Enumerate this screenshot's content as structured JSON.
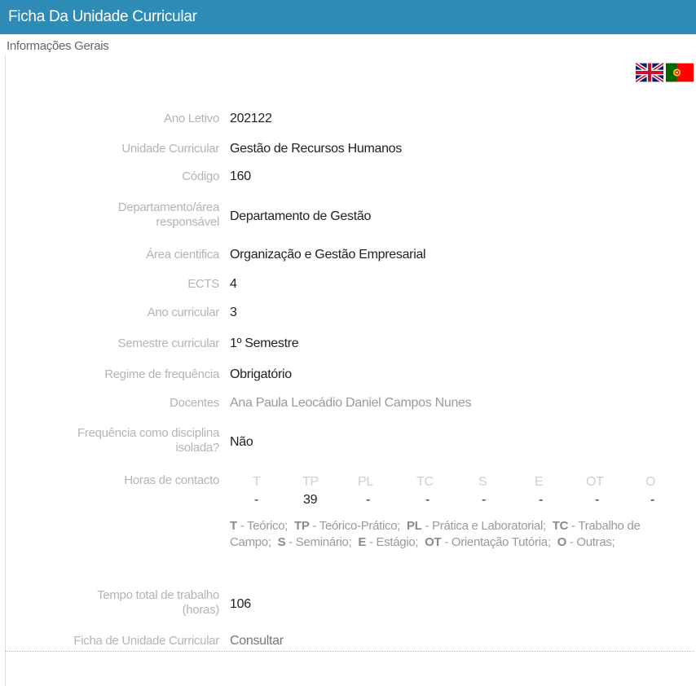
{
  "header": {
    "title": "Ficha Da Unidade Curricular"
  },
  "section": {
    "title": "Informações Gerais"
  },
  "fields": {
    "ano_letivo": {
      "label": "Ano Letivo",
      "value": "202122"
    },
    "unidade_curricular": {
      "label": "Unidade Curricular",
      "value": "Gestão de Recursos Humanos"
    },
    "codigo": {
      "label": "Código",
      "value": "160"
    },
    "departamento": {
      "label_line1": "Departamento/área",
      "label_line2": "responsável",
      "value": "Departamento de Gestão"
    },
    "area_cientifica": {
      "label": "Área cientifica",
      "value": "Organização e Gestão Empresarial"
    },
    "ects": {
      "label": "ECTS",
      "value": "4"
    },
    "ano_curricular": {
      "label": "Ano curricular",
      "value": "3"
    },
    "semestre": {
      "label": "Semestre curricular",
      "value": "1º Semestre"
    },
    "regime": {
      "label": "Regime de frequência",
      "value": "Obrigatório"
    },
    "docentes": {
      "label": "Docentes",
      "value": "Ana Paula Leocádio Daniel Campos Nunes"
    },
    "frequencia_isolada": {
      "label_line1": "Frequência como disciplina",
      "label_line2": "isolada?",
      "value": "Não"
    },
    "horas_contacto": {
      "label": "Horas de contacto",
      "types": [
        {
          "code": "T",
          "value": "-"
        },
        {
          "code": "TP",
          "value": "39"
        },
        {
          "code": "PL",
          "value": "-"
        },
        {
          "code": "TC",
          "value": "-"
        },
        {
          "code": "S",
          "value": "-"
        },
        {
          "code": "E",
          "value": "-"
        },
        {
          "code": "OT",
          "value": "-"
        },
        {
          "code": "O",
          "value": "-"
        }
      ],
      "legend": [
        {
          "code": "T",
          "text": " - Teórico;"
        },
        {
          "code": "TP",
          "text": " - Teórico-Prático;"
        },
        {
          "code": "PL",
          "text": " - Prática e Laboratorial;"
        },
        {
          "code": "TC",
          "text": " - Trabalho de Campo;"
        },
        {
          "code": "S",
          "text": " - Seminário;"
        },
        {
          "code": "E",
          "text": " - Estágio;"
        },
        {
          "code": "OT",
          "text": " - Orientação Tutória;"
        },
        {
          "code": "O",
          "text": " - Outras;"
        }
      ]
    },
    "tempo_total": {
      "label_line1": "Tempo total de trabalho",
      "label_line2": "(horas)",
      "value": "106"
    },
    "ficha": {
      "label": "Ficha de Unidade Curricular",
      "value": "Consultar"
    }
  },
  "languages": {
    "english_icon": "uk-flag-icon",
    "portuguese_icon": "portugal-flag-icon"
  },
  "colors": {
    "header_bg": "#2d8bb6",
    "label": "#b4b4b4",
    "value": "#1f1f1f"
  }
}
